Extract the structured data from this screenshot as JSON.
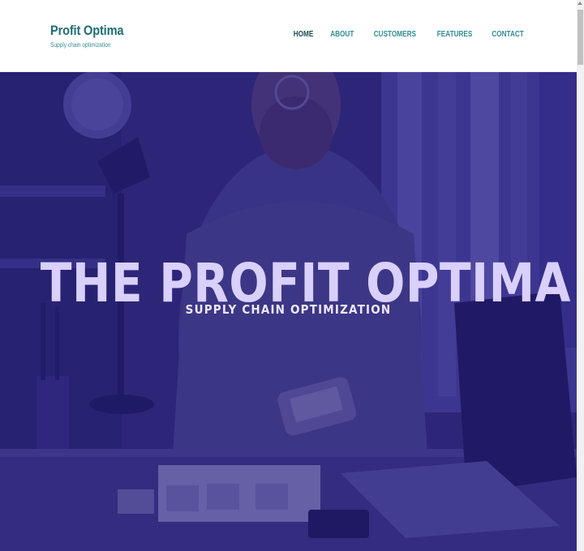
{
  "brand": {
    "name": "Profit Optima",
    "tagline": "Supply chain optimization"
  },
  "nav": {
    "items": [
      "HOME",
      "ABOUT",
      "CUSTOMERS",
      "FEATURES",
      "CONTACT"
    ],
    "active": "HOME"
  },
  "hero": {
    "title": "THE PROFIT OPTIMA",
    "subtitle": "SUPPLY CHAIN OPTIMIZATION",
    "image": "man-counting-money-photo"
  },
  "colors": {
    "brand": "#1e6e74",
    "nav_link": "#2f8e93",
    "overlay": "#221c80",
    "hero_title": "#d9d0fb"
  }
}
